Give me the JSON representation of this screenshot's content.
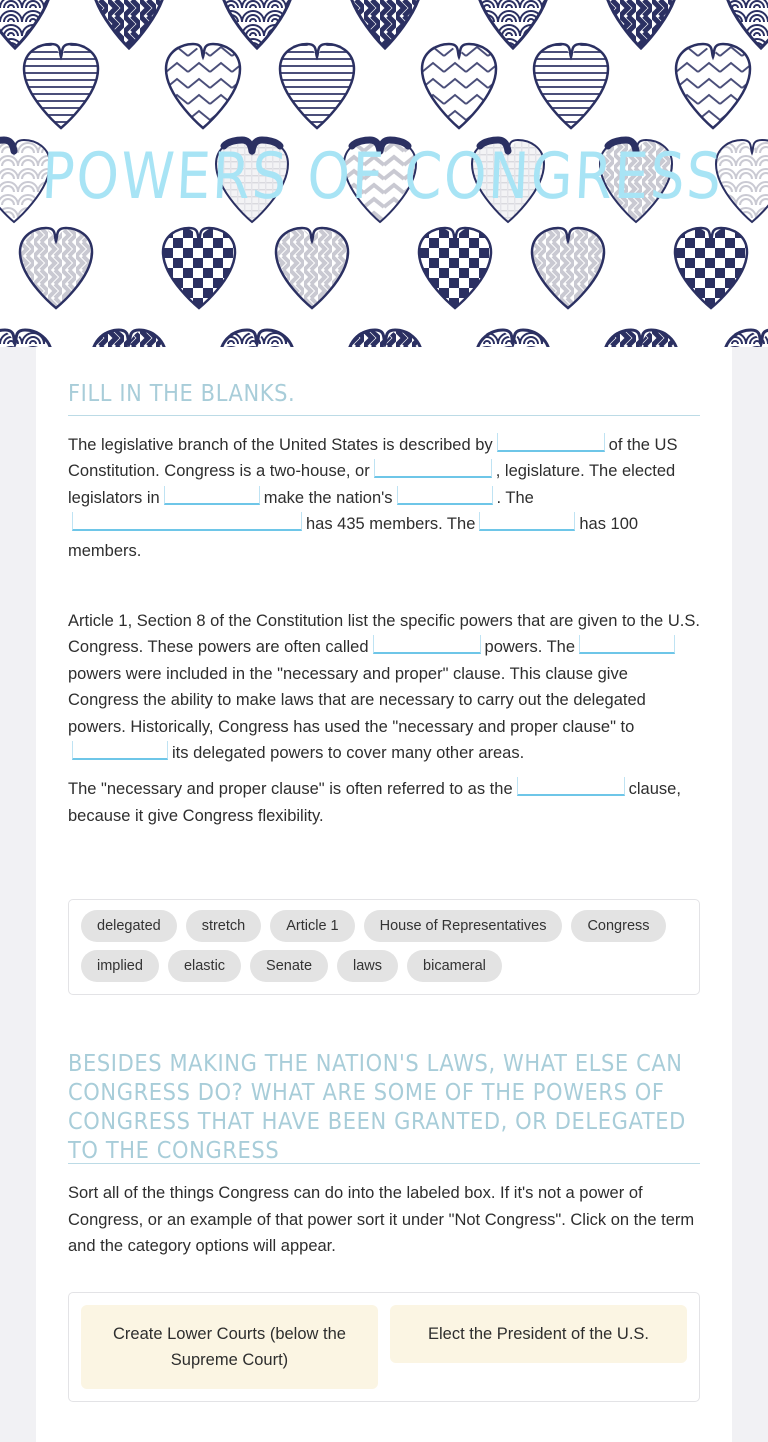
{
  "banner": {
    "title": "Powers of Congress",
    "title_color": "#a8e4f5",
    "background_color": "#ffffff",
    "heart_colors": {
      "navy": "#2b3062",
      "gray": "#c9c9cf",
      "outline": "#2b3062"
    }
  },
  "page": {
    "background_color": "#f1f1f4",
    "sheet_color": "#ffffff"
  },
  "section1": {
    "heading": "Fill in the blanks.",
    "heading_color": "#a8cdd9",
    "blank_color": "#6ec6e8",
    "p1": {
      "t1": "The legislative branch of the United States is described by",
      "t2": "of the US Constitution. Congress is a two-house, or",
      "t3": ", legislature. The elected legislators in",
      "t4": "make the nation's",
      "t5": ". The",
      "t6": "has 435 members. The",
      "t7": "has 100 members."
    },
    "p2": {
      "t1": "Article 1, Section 8 of the Constitution list the specific powers that are given to the U.S. Congress. These powers are often called",
      "t2": "powers. The",
      "t3": "powers were included in the \"necessary and proper\" clause. This clause give Congress the ability to make laws that are necessary to carry out the delegated powers. Historically, Congress has used the \"necessary and proper clause\" to",
      "t4": "its delegated powers to cover many other areas."
    },
    "p3": {
      "t1": "The \"necessary and proper clause\" is often referred to as the",
      "t2": "clause, because it give Congress flexibility."
    }
  },
  "wordbank": {
    "chips": [
      "delegated",
      "stretch",
      "Article 1",
      "House of Representatives",
      "Congress",
      "implied",
      "elastic",
      "Senate",
      "laws",
      "bicameral"
    ]
  },
  "section2": {
    "heading": "Besides making the nation's laws, what else can Congress do?  What are some of the powers of Congress that have been granted, or delegated to the Congress",
    "instructions": "Sort all of the things Congress can do into the labeled box.  If it's not a power of Congress,  or an example of that power sort it under \"Not Congress\".  Click on the term and the category options will appear.",
    "cards": [
      "Create Lower Courts (below the Supreme Court)",
      "Elect the President of the U.S."
    ],
    "card_color": "#fbf5e3"
  }
}
